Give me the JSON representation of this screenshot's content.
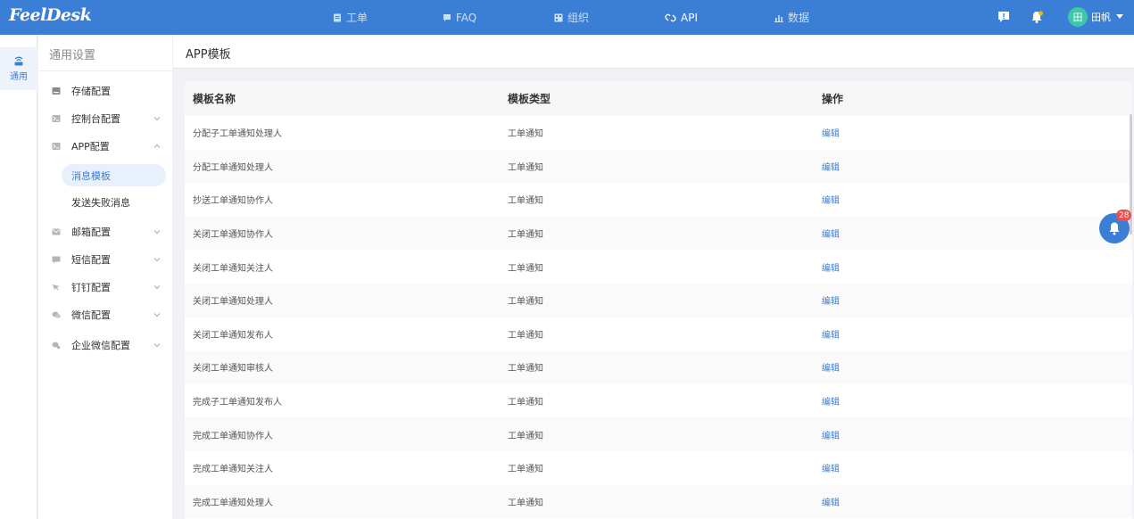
{
  "brand": {
    "logo_text": "FeelDesk"
  },
  "topnav": {
    "items": [
      {
        "label": "工单",
        "icon": "ticket-icon"
      },
      {
        "label": "FAQ",
        "icon": "faq-icon"
      },
      {
        "label": "组织",
        "icon": "org-icon"
      },
      {
        "label": "API",
        "icon": "api-icon",
        "active": true
      },
      {
        "label": "数据",
        "icon": "chart-icon"
      }
    ],
    "user_avatar": "田",
    "user_name": "田帆"
  },
  "rail": {
    "items": [
      {
        "label": "通用",
        "icon": "wifi-router-icon",
        "active": true
      }
    ]
  },
  "sidebar": {
    "title": "通用设置",
    "items": [
      {
        "label": "存储配置",
        "icon": "storage-icon"
      },
      {
        "label": "控制台配置",
        "icon": "console-icon",
        "chevron": "down"
      },
      {
        "label": "APP配置",
        "icon": "app-icon",
        "chevron": "up"
      },
      {
        "label": "消息模板",
        "sub": true,
        "active": true
      },
      {
        "label": "发送失败消息",
        "sub": true
      },
      {
        "label": "邮箱配置",
        "icon": "mail-icon",
        "chevron": "down"
      },
      {
        "label": "短信配置",
        "icon": "sms-icon",
        "chevron": "down"
      },
      {
        "label": "钉钉配置",
        "icon": "dingtalk-icon",
        "chevron": "down"
      },
      {
        "label": "微信配置",
        "icon": "wechat-icon",
        "chevron": "down"
      },
      {
        "label": "企业微信配置",
        "icon": "wecom-icon",
        "chevron": "down"
      }
    ]
  },
  "main": {
    "title": "APP模板",
    "table": {
      "columns": [
        "模板名称",
        "模板类型",
        "操作"
      ],
      "rows": [
        {
          "name": "分配子工单通知处理人",
          "type": "工单通知",
          "action": "编辑"
        },
        {
          "name": "分配工单通知处理人",
          "type": "工单通知",
          "action": "编辑"
        },
        {
          "name": "抄送工单通知协作人",
          "type": "工单通知",
          "action": "编辑"
        },
        {
          "name": "关闭工单通知协作人",
          "type": "工单通知",
          "action": "编辑"
        },
        {
          "name": "关闭工单通知关注人",
          "type": "工单通知",
          "action": "编辑"
        },
        {
          "name": "关闭工单通知处理人",
          "type": "工单通知",
          "action": "编辑"
        },
        {
          "name": "关闭工单通知发布人",
          "type": "工单通知",
          "action": "编辑"
        },
        {
          "name": "关闭工单通知审核人",
          "type": "工单通知",
          "action": "编辑"
        },
        {
          "name": "完成子工单通知发布人",
          "type": "工单通知",
          "action": "编辑"
        },
        {
          "name": "完成工单通知协作人",
          "type": "工单通知",
          "action": "编辑"
        },
        {
          "name": "完成工单通知关注人",
          "type": "工单通知",
          "action": "编辑"
        },
        {
          "name": "完成工单通知处理人",
          "type": "工单通知",
          "action": "编辑"
        }
      ]
    }
  },
  "notification_fab": {
    "count": "28"
  },
  "colors": {
    "brand": "#3a7fd5",
    "badge": "#f04d4d",
    "avatar": "#3dc9a7"
  }
}
